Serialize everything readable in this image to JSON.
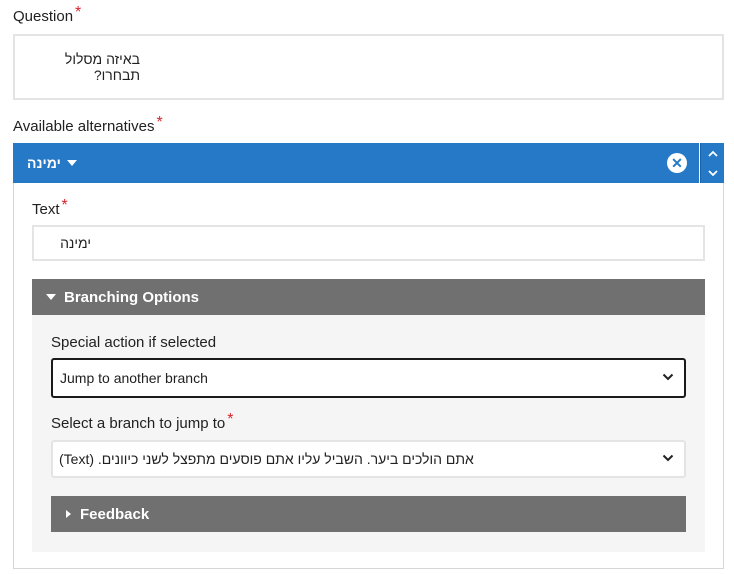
{
  "question": {
    "label": "Question",
    "required_mark": "*",
    "value": "באיזה מסלול תבחרו?"
  },
  "alternatives": {
    "label": "Available alternatives",
    "required_mark": "*",
    "item": {
      "title": "ימינה",
      "text_label": "Text",
      "text_required_mark": "*",
      "text_value": "ימינה",
      "branching": {
        "title": "Branching Options",
        "special_action_label": "Special action if selected",
        "special_action_value": "Jump to another branch",
        "jump_label": "Select a branch to jump to",
        "jump_required_mark": "*",
        "jump_value": "אתם הולכים ביער. השביל עליו אתם פוסעים מתפצל לשני כיוונים.  (Text)",
        "feedback_title": "Feedback"
      }
    }
  },
  "colors": {
    "accent": "#2579c6",
    "required": "#d9232e",
    "section_header": "#707070"
  },
  "icons": {
    "collapse": "caret-down-icon",
    "remove": "close-circle-icon",
    "move_up": "chevron-up-icon",
    "move_down": "chevron-down-icon",
    "expand": "caret-right-icon"
  }
}
